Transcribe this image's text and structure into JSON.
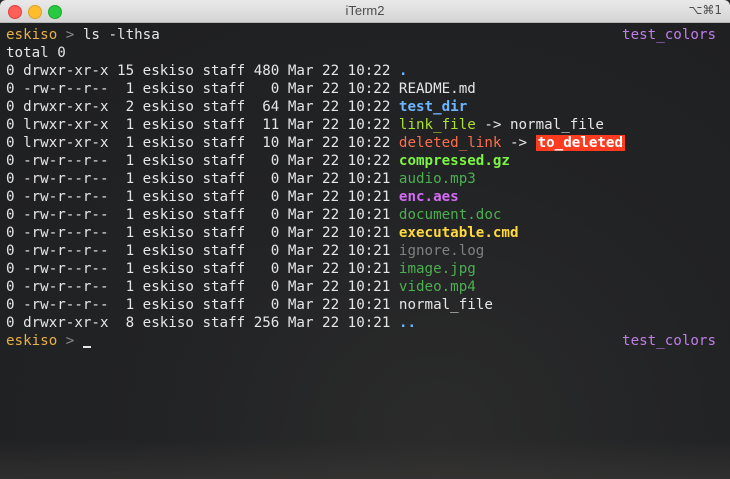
{
  "window": {
    "title": "iTerm2",
    "shortcut": "⌥⌘1"
  },
  "prompt": {
    "user": "eskiso",
    "symbol": ">",
    "command": "ls -lthsa",
    "right_label": "test_colors"
  },
  "total_line": "total 0",
  "rows": [
    {
      "meta": "0 drwxr-xr-x 15 eskiso staff 480 Mar 22 10:22 ",
      "name": ".",
      "kind": "dir"
    },
    {
      "meta": "0 -rw-r--r--  1 eskiso staff   0 Mar 22 10:22 ",
      "name": "README.md",
      "kind": "normal"
    },
    {
      "meta": "0 drwxr-xr-x  2 eskiso staff  64 Mar 22 10:22 ",
      "name": "test_dir",
      "kind": "dir"
    },
    {
      "meta": "0 lrwxr-xr-x  1 eskiso staff  11 Mar 22 10:22 ",
      "name": "link_file",
      "kind": "link",
      "link_arrow": " -> ",
      "link_target": "normal_file"
    },
    {
      "meta": "0 lrwxr-xr-x  1 eskiso staff  10 Mar 22 10:22 ",
      "name": "deleted_link",
      "kind": "broken",
      "link_arrow": " -> ",
      "link_target": "to_deleted"
    },
    {
      "meta": "0 -rw-r--r--  1 eskiso staff   0 Mar 22 10:22 ",
      "name": "compressed.gz",
      "kind": "archive"
    },
    {
      "meta": "0 -rw-r--r--  1 eskiso staff   0 Mar 22 10:21 ",
      "name": "audio.mp3",
      "kind": "audio"
    },
    {
      "meta": "0 -rw-r--r--  1 eskiso staff   0 Mar 22 10:21 ",
      "name": "enc.aes",
      "kind": "crypt"
    },
    {
      "meta": "0 -rw-r--r--  1 eskiso staff   0 Mar 22 10:21 ",
      "name": "document.doc",
      "kind": "docf"
    },
    {
      "meta": "0 -rw-r--r--  1 eskiso staff   0 Mar 22 10:21 ",
      "name": "executable.cmd",
      "kind": "exec"
    },
    {
      "meta": "0 -rw-r--r--  1 eskiso staff   0 Mar 22 10:21 ",
      "name": "ignore.log",
      "kind": "ignored"
    },
    {
      "meta": "0 -rw-r--r--  1 eskiso staff   0 Mar 22 10:21 ",
      "name": "image.jpg",
      "kind": "image"
    },
    {
      "meta": "0 -rw-r--r--  1 eskiso staff   0 Mar 22 10:21 ",
      "name": "video.mp4",
      "kind": "video"
    },
    {
      "meta": "0 -rw-r--r--  1 eskiso staff   0 Mar 22 10:21 ",
      "name": "normal_file",
      "kind": "normal"
    },
    {
      "meta": "0 drwxr-xr-x  8 eskiso staff 256 Mar 22 10:21 ",
      "name": "..",
      "kind": "dir"
    }
  ],
  "colors": {
    "background": "#1d1f21",
    "prompt_user": "#e8b04a",
    "right_label": "#c07de8",
    "dir": "#6cb6ff",
    "link": "#a6e22e",
    "broken_link": "#ff6e4a",
    "broken_target_bg": "#ff3b1f"
  }
}
